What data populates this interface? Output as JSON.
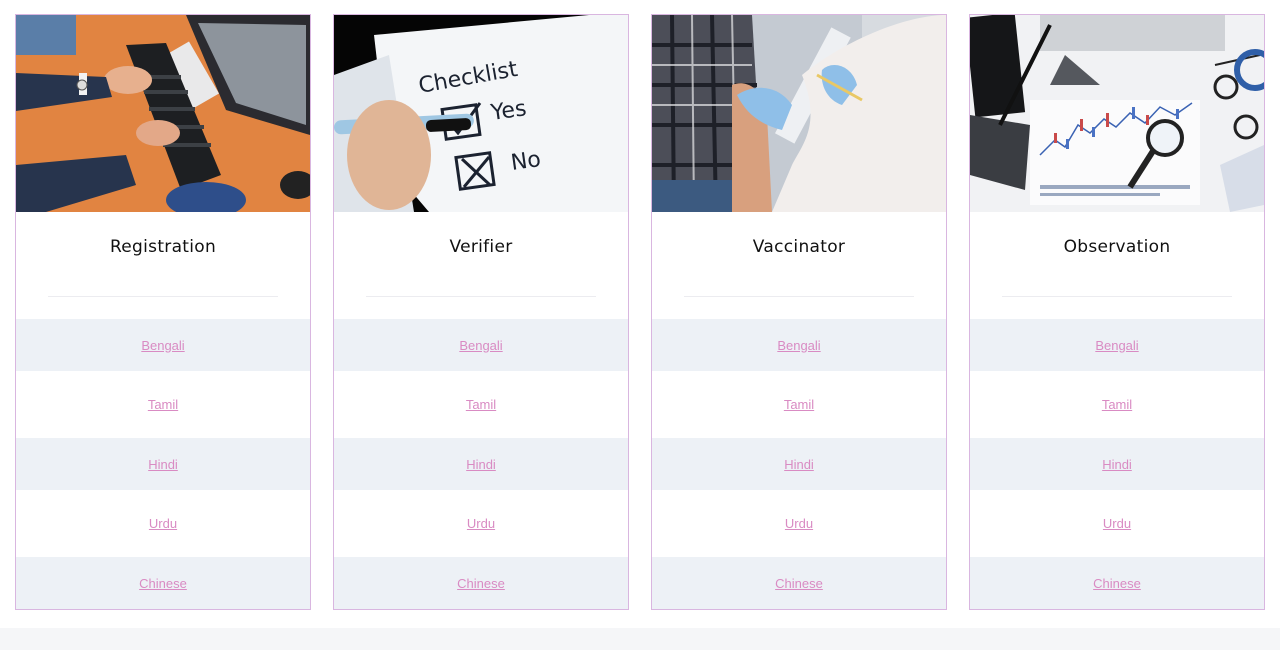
{
  "cards": [
    {
      "title": "Registration",
      "image": "typing-on-keyboard-photo",
      "languages": [
        "Bengali",
        "Tamil",
        "Hindi",
        "Urdu",
        "Chinese"
      ]
    },
    {
      "title": "Verifier",
      "image": "checklist-photo",
      "checklist": {
        "heading": "Checklist",
        "yes": "Yes",
        "no": "No"
      },
      "languages": [
        "Bengali",
        "Tamil",
        "Hindi",
        "Urdu",
        "Chinese"
      ]
    },
    {
      "title": "Vaccinator",
      "image": "vaccination-photo",
      "languages": [
        "Bengali",
        "Tamil",
        "Hindi",
        "Urdu",
        "Chinese"
      ]
    },
    {
      "title": "Observation",
      "image": "charts-magnifier-photo",
      "languages": [
        "Bengali",
        "Tamil",
        "Hindi",
        "Urdu",
        "Chinese"
      ]
    }
  ],
  "colors": {
    "link": "#d98bc3",
    "card_border": "#d9b6e0",
    "row_shade": "#edf1f6"
  }
}
